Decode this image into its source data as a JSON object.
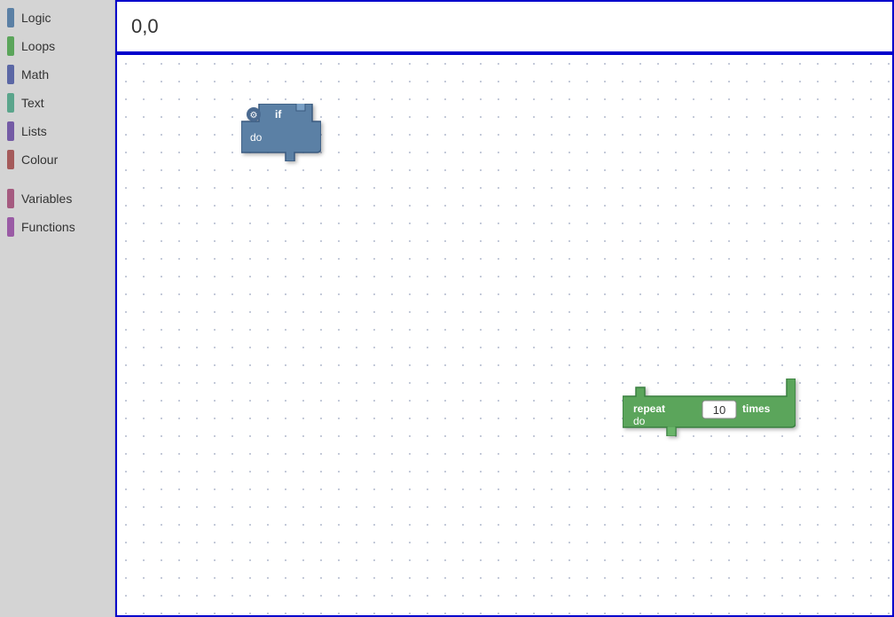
{
  "sidebar": {
    "items": [
      {
        "id": "logic",
        "label": "Logic",
        "color": "#5b80a5"
      },
      {
        "id": "loops",
        "label": "Loops",
        "color": "#5ba55b"
      },
      {
        "id": "math",
        "label": "Math",
        "color": "#5b67a5"
      },
      {
        "id": "text",
        "label": "Text",
        "color": "#5ba58c"
      },
      {
        "id": "lists",
        "label": "Lists",
        "color": "#745ba5"
      },
      {
        "id": "colour",
        "label": "Colour",
        "color": "#a55b5b"
      },
      {
        "id": "variables",
        "label": "Variables",
        "color": "#a55b80"
      },
      {
        "id": "functions",
        "label": "Functions",
        "color": "#9a5ba5"
      }
    ]
  },
  "coord": {
    "label": "0,0"
  },
  "if_block": {
    "keyword": "if",
    "second_keyword": "do"
  },
  "repeat_block": {
    "repeat_label": "repeat",
    "times_label": "times",
    "do_label": "do",
    "value": "10"
  }
}
